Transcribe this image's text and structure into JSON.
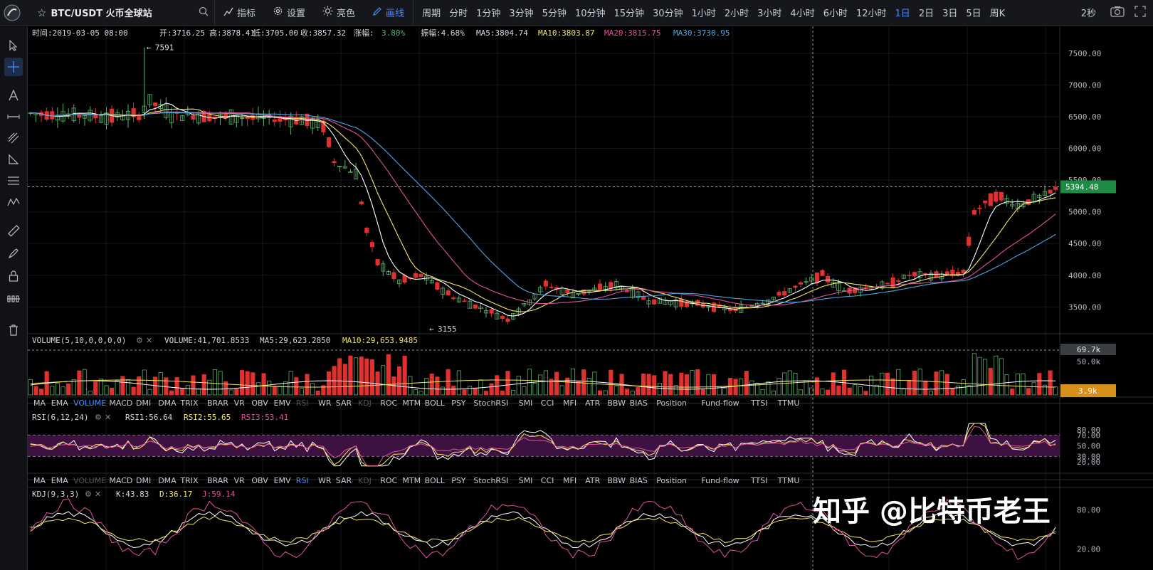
{
  "topbar": {
    "symbol": "BTC/USDT 火币全球站",
    "indicator_label": "指标",
    "settings_label": "设置",
    "theme_label": "亮色",
    "draw_label": "画线",
    "period_label": "周期",
    "periods": [
      "分时",
      "1分钟",
      "3分钟",
      "5分钟",
      "10分钟",
      "15分钟",
      "30分钟",
      "1小时",
      "2小时",
      "3小时",
      "4小时",
      "6小时",
      "12小时",
      "1日",
      "2日",
      "3日",
      "5日",
      "周K"
    ],
    "active_period": "1日",
    "refresh": "2秒"
  },
  "main_info": {
    "time": "时间:2019-03-05 08:00",
    "open": "开:3716.25",
    "high": "高:3878.41",
    "low": "低:3705.00",
    "close": "收:3857.32",
    "change_label": "涨幅:",
    "change_value": "3.80%",
    "amplitude": "振幅:4.68%",
    "ma5": "MA5:3804.74",
    "ma10": "MA10:3803.87",
    "ma20": "MA20:3815.75",
    "ma30": "MA30:3730.95"
  },
  "price_axis": {
    "ticks": [
      "7500.00",
      "7000.00",
      "6500.00",
      "6000.00",
      "5500.00",
      "5000.00",
      "4500.00",
      "4000.00",
      "3500.00"
    ],
    "current_price": "5394.48",
    "max_marker": "7591",
    "min_marker": "3155"
  },
  "volume": {
    "title": "VOLUME(5,10,0,0,0,0)",
    "value": "VOLUME:41,701.8533",
    "ma5": "MA5:29,623.2850",
    "ma10": "MA10:29,653.9485",
    "axis_max": "69.7k",
    "axis_mid": "50.0k",
    "current": "3.9k"
  },
  "indicator_tabs": [
    "MA",
    "EMA",
    "VOLUME",
    "MACD",
    "DMI",
    "DMA",
    "TRIX",
    "BRAR",
    "VR",
    "OBV",
    "EMV",
    "RSI",
    "WR",
    "SAR",
    "KDJ",
    "ROC",
    "MTM",
    "BOLL",
    "PSY",
    "StochRSI",
    "SMI",
    "CCI",
    "MFI",
    "ATR",
    "BBW",
    "BIAS",
    "Position",
    "Fund-flow",
    "TTSI",
    "TTMU"
  ],
  "rsi": {
    "title": "RSI(6,12,24)",
    "rsi1": "RSI1:56.64",
    "rsi2": "RSI2:55.65",
    "rsi3": "RSI3:53.41",
    "axis": [
      "80.00",
      "70.00",
      "50.00",
      "30.00",
      "20.00"
    ]
  },
  "kdj": {
    "title": "KDJ(9,3,3)",
    "k": "K:43.83",
    "d": "D:36.17",
    "j": "J:59.14",
    "axis": [
      "80.00",
      "20.00"
    ]
  },
  "watermark": "知乎 @比特币老王",
  "colors": {
    "up": "#5ab26a",
    "down": "#e0312f",
    "ma5": "#ffffff",
    "ma10": "#f5e663",
    "ma20": "#e0529c",
    "ma30": "#4da6e0",
    "active": "#4a8cff",
    "price_tag": "#1f8a43",
    "volume_tag": "#d7901a"
  }
}
